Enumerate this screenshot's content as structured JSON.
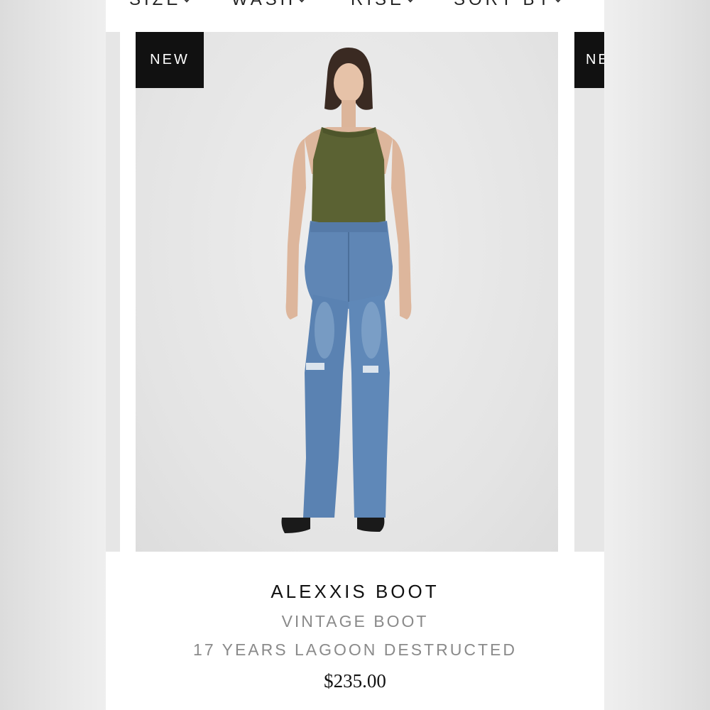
{
  "filters": [
    {
      "label": "SIZE"
    },
    {
      "label": "WASH"
    },
    {
      "label": "RISE"
    },
    {
      "label": "SORT BY"
    }
  ],
  "icons": {
    "filter_dropdown": "chevron-down-icon"
  },
  "product": {
    "badge": "NEW",
    "name": "ALEXXIS BOOT",
    "fit": "VINTAGE BOOT",
    "wash": "17 YEARS LAGOON DESTRUCTED",
    "price": "$235.00"
  },
  "next_product": {
    "badge": "NE"
  },
  "colors": {
    "badge_bg": "#111111",
    "muted_text": "#8a8a8a",
    "tank_top": "#5b6233",
    "denim": "#5f86b5"
  }
}
